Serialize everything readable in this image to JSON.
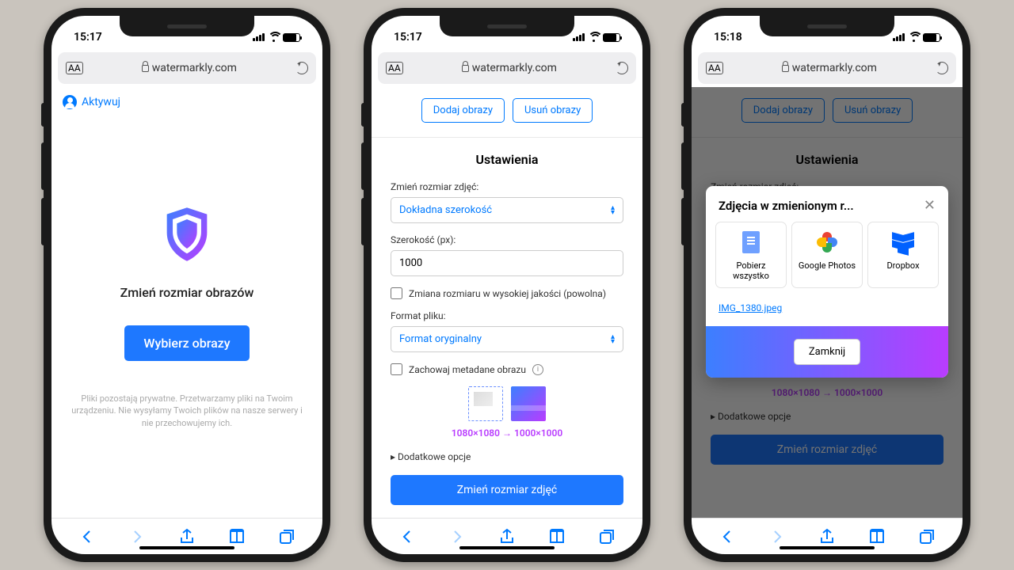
{
  "common": {
    "url": "watermarkly.com",
    "toolbar_icons": [
      "back",
      "forward",
      "share",
      "bookmarks",
      "tabs"
    ]
  },
  "phone1": {
    "time": "15:17",
    "activate": "Aktywuj",
    "heading": "Zmień rozmiar obrazów",
    "choose_btn": "Wybierz obrazy",
    "privacy": "Pliki pozostają prywatne. Przetwarzamy pliki na Twoim urządzeniu. Nie wysyłamy Twoich plików na nasze serwery i nie przechowujemy ich."
  },
  "phone2": {
    "time": "15:17",
    "add_btn": "Dodaj obrazy",
    "del_btn": "Usuń obrazy",
    "settings_title": "Ustawienia",
    "resize_label": "Zmień rozmiar zdjęć:",
    "resize_value": "Dokładna szerokość",
    "width_label": "Szerokość (px):",
    "width_value": "1000",
    "hq_label": "Zmiana rozmiaru w wysokiej jakości (powolna)",
    "format_label": "Format pliku:",
    "format_value": "Format oryginalny",
    "meta_label": "Zachowaj metadane obrazu",
    "dims": "1080×1080 → 1000×1000",
    "more": "▸ Dodatkowe opcje",
    "submit": "Zmień rozmiar zdjęć"
  },
  "phone3": {
    "time": "15:18",
    "add_btn": "Dodaj obrazy",
    "del_btn": "Usuń obrazy",
    "settings_title": "Ustawienia",
    "resize_label": "Zmień rozmiar zdjęć:",
    "dims": "1080×1080 → 1000×1000",
    "more": "▸ Dodatkowe opcje",
    "submit": "Zmień rozmiar zdjęć",
    "modal_title": "Zdjęcia w zmienionym r...",
    "opt1": "Pobierz wszystko",
    "opt2": "Google Photos",
    "opt3": "Dropbox",
    "file": "IMG_1380.jpeg",
    "close": "Zamknij"
  }
}
